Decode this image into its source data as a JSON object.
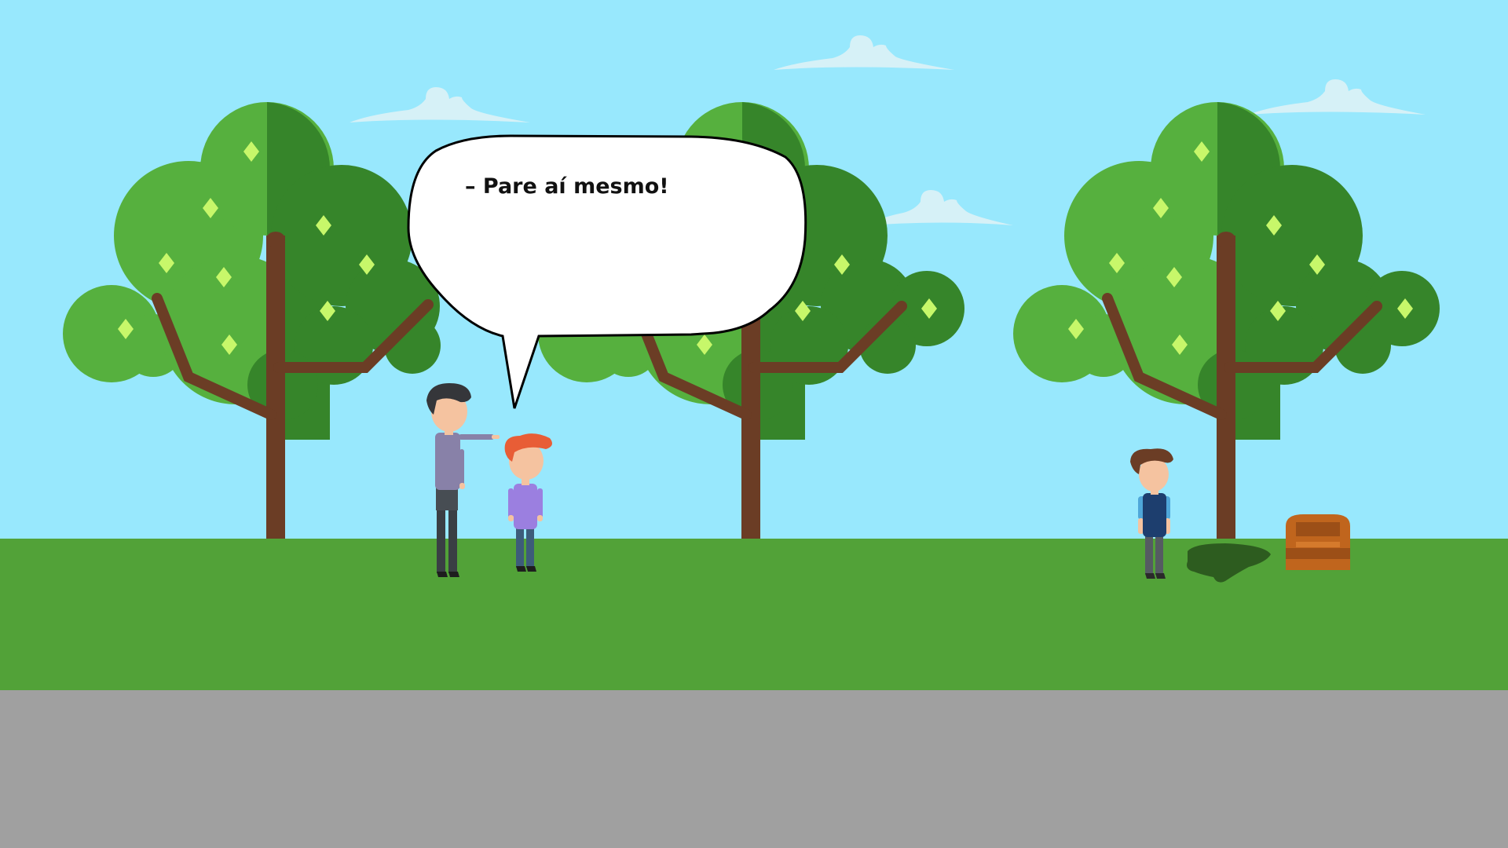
{
  "scene": {
    "speech_bubble": {
      "text": "– Pare aí mesmo!"
    },
    "colors": {
      "sky": "#98e8fd",
      "grass": "#52a238",
      "road": "#a0a0a0",
      "tree_light": "#56b03e",
      "tree_dark": "#36852a",
      "trunk": "#6b3d25",
      "fruit": "#c7f76a",
      "cloud": "#d6f1f7"
    },
    "characters": [
      {
        "name": "adult-man",
        "shirt": "#8881a8"
      },
      {
        "name": "red-haired-child",
        "shirt": "#9b7fe0"
      },
      {
        "name": "boy-near-tree",
        "shirt": "#1d3e6e"
      }
    ],
    "objects": [
      "hole",
      "treasure-chest"
    ]
  }
}
